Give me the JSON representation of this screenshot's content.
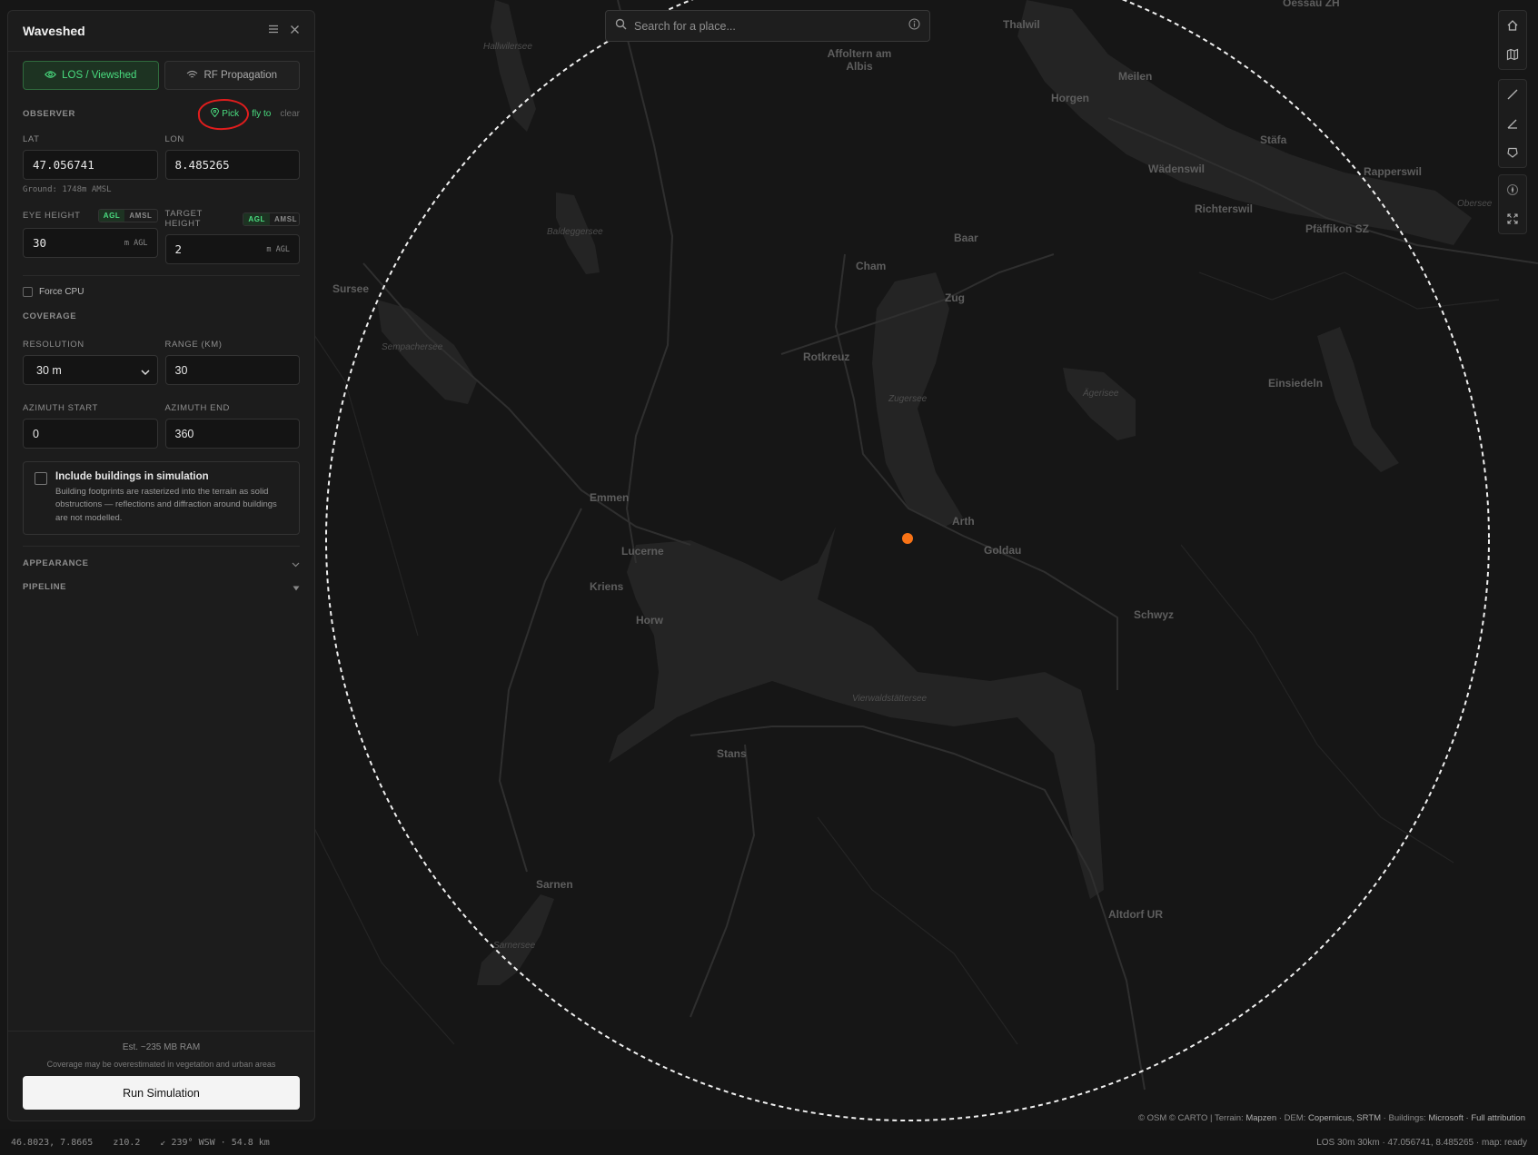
{
  "app": {
    "title": "Waveshed"
  },
  "modes": [
    {
      "label": "LOS / Viewshed",
      "icon": "eye-icon",
      "active": true
    },
    {
      "label": "RF Propagation",
      "icon": "wifi-icon",
      "active": false
    }
  ],
  "observer": {
    "section_label": "OBSERVER",
    "pick_label": "Pick",
    "flyto_label": "fly to",
    "clear_label": "clear",
    "lat_label": "LAT",
    "lon_label": "LON",
    "lat": "47.056741",
    "lon": "8.485265",
    "ground": "Ground: 1748m AMSL"
  },
  "heights": {
    "eye_label": "EYE HEIGHT",
    "target_label": "TARGET HEIGHT",
    "agl": "AGL",
    "amsl": "AMSL",
    "eye_value": "30",
    "target_value": "2",
    "unit": "m AGL"
  },
  "force_cpu": {
    "label": "Force CPU",
    "checked": false
  },
  "coverage": {
    "section_label": "COVERAGE",
    "resolution_label": "RESOLUTION",
    "resolution_value": "30 m",
    "range_label": "RANGE (KM)",
    "range_value": "30",
    "az_start_label": "AZIMUTH START",
    "az_start_value": "0",
    "az_end_label": "AZIMUTH END",
    "az_end_value": "360"
  },
  "buildings": {
    "title": "Include buildings in simulation",
    "description": "Building footprints are rasterized into the terrain as solid obstructions — reflections and diffraction around buildings are not modelled.",
    "checked": false
  },
  "sections": {
    "appearance": "APPEARANCE",
    "pipeline": "PIPELINE"
  },
  "footer": {
    "estimate": "Est. ~235 MB RAM",
    "warning": "Coverage may be overestimated in vegetation and urban areas",
    "run_label": "Run Simulation"
  },
  "search": {
    "placeholder": "Search for a place..."
  },
  "attribution": {
    "prefix": "© OSM © CARTO | Terrain: ",
    "terrain": "Mapzen",
    "dem_prefix": " · DEM: ",
    "dem": "Copernicus, SRTM",
    "bld_prefix": " · Buildings: ",
    "bld": "Microsoft",
    "full": " · Full attribution"
  },
  "status": {
    "cursor": "46.8023, 7.8665",
    "zoom": "z10.2",
    "bearing": "↙ 239° WSW · 54.8 km",
    "summary": "LOS 30m 30km · 47.056741, 8.485265 · map: ready"
  },
  "map_labels": {
    "towns": [
      "Thalwil",
      "Affoltern am Albis",
      "Meilen",
      "Horgen",
      "Stäfa",
      "Wädenswil",
      "Rapperswil",
      "Richterswil",
      "Pfäffikon SZ",
      "Baar",
      "Cham",
      "Zug",
      "Sursee",
      "Rotkreuz",
      "Einsiedeln",
      "Emmen",
      "Lucerne",
      "Arth",
      "Goldau",
      "Kriens",
      "Horw",
      "Schwyz",
      "Stans",
      "Sarnen",
      "Altdorf UR",
      "Oessau ZH"
    ],
    "waters": [
      "Hallwilersee",
      "Baldeggersee",
      "Sempachersee",
      "Zugersee",
      "Ägerisee",
      "Vierwaldstättersee",
      "Sarnersee",
      "Obersee"
    ]
  },
  "colors": {
    "accent": "#4ade80",
    "observer": "#f97316",
    "annotation": "#e11d1d"
  }
}
